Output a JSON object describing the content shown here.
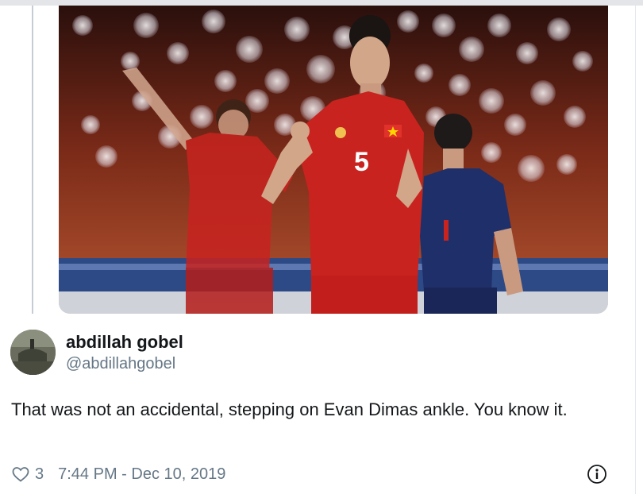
{
  "tweet": {
    "author_name": "abdillah gobel",
    "author_handle": "@abdillahgobel",
    "text": "That was not an accidental, stepping on Evan Dimas ankle. You know it.",
    "like_count": "3",
    "timestamp": "7:44 PM - Dec 10, 2019"
  },
  "media": {
    "jersey_number": "5"
  },
  "icons": {
    "like": "heart-icon",
    "info": "info-icon"
  },
  "colors": {
    "text_primary": "#14171a",
    "text_secondary": "#657786",
    "jersey_red": "#c8231f",
    "opponent_blue": "#1f2f6a"
  }
}
